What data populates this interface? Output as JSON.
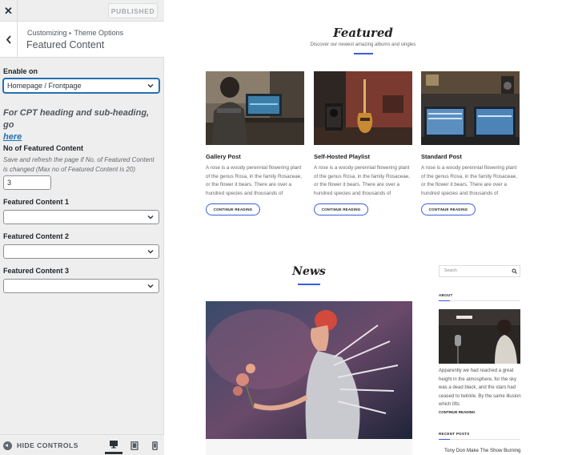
{
  "customizer": {
    "published_label": "PUBLISHED",
    "breadcrumb_root": "Customizing",
    "breadcrumb_parent": "Theme Options",
    "section_title": "Featured Content",
    "enable_on_label": "Enable on",
    "enable_on_value": "Homepage / Frontpage",
    "cpt_note_text": "For CPT heading and sub-heading, go",
    "cpt_link_text": "here",
    "num_label": "No of Featured Content",
    "num_description": "Save and refresh the page if No. of Featured Content is changed (Max no of Featured Content is 20)",
    "num_value": "3",
    "content_1_label": "Featured Content 1",
    "content_2_label": "Featured Content 2",
    "content_3_label": "Featured Content 3",
    "hide_controls_label": "HIDE CONTROLS"
  },
  "preview": {
    "featured_title": "Featured",
    "featured_subtitle": "Discover our newest amazing albums and singles",
    "accent_color": "#3b5ddd",
    "cards": [
      {
        "title": "Gallery Post",
        "excerpt": "A rose is a woody perennial flowering plant of the genus Rosa, in the family Rosaceae, or the flower it bears. There are over a hundred species and thousands of",
        "button": "CONTINUE READING"
      },
      {
        "title": "Self-Hosted Playlist",
        "excerpt": "A rose is a woody perennial flowering plant of the genus Rosa, in the family Rosaceae, or the flower it bears. There are over a hundred species and thousands of",
        "button": "CONTINUE READING"
      },
      {
        "title": "Standard Post",
        "excerpt": "A rose is a woody perennial flowering plant of the genus Rosa, in the family Rosaceae, or the flower it bears. There are over a hundred species and thousands of",
        "button": "CONTINUE READING"
      }
    ],
    "news_title": "News",
    "search_placeholder": "Search",
    "about_title": "ABOUT",
    "about_text": "Apparently we had reached a great height in the atmosphere, for the sky was a dead black, and the stars had ceased to twinkle. By the same illusion which lifts",
    "about_more": "CONTINUE READING",
    "recent_posts_title": "RECENT POSTS",
    "recent_post_1": "Tony Don Make The Show Burning"
  }
}
